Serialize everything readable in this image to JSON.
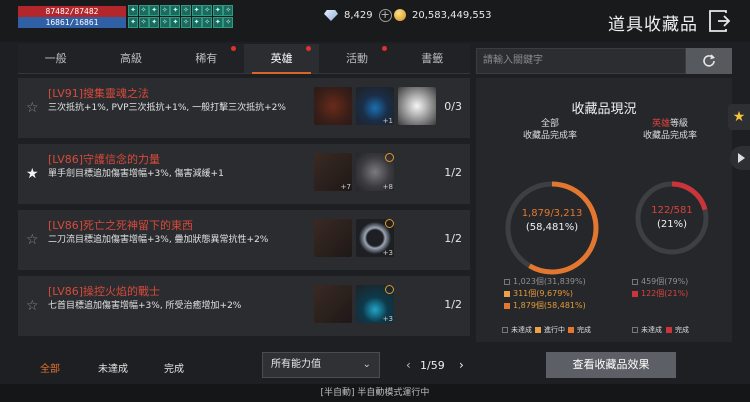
{
  "hud": {
    "hp": "87482/87482",
    "mp": "16861/16861",
    "buffs": [
      "✦",
      "✧",
      "✦",
      "✧",
      "✦",
      "✧",
      "✦",
      "✧",
      "✦",
      "✧",
      "✦",
      "✧",
      "✦",
      "✧",
      "✦",
      "✧",
      "✦",
      "✧",
      "✦",
      "✧"
    ]
  },
  "currency": {
    "diamonds": "8,429",
    "gold": "20,583,449,553"
  },
  "header": {
    "title": "道具收藏品"
  },
  "tabs": [
    {
      "label": "一般",
      "active": false,
      "dot": false
    },
    {
      "label": "高級",
      "active": false,
      "dot": false
    },
    {
      "label": "稀有",
      "active": false,
      "dot": true
    },
    {
      "label": "英雄",
      "active": true,
      "dot": true
    },
    {
      "label": "活動",
      "active": false,
      "dot": true
    },
    {
      "label": "書籤",
      "active": false,
      "dot": false
    }
  ],
  "collections": [
    {
      "title": "[LV91]搜集靈魂之法",
      "desc": "三次抵抗+1%, PVP三次抵抗+1%, 一般打擊三次抵抗+2%",
      "count": "0/3",
      "starred": false,
      "items": [
        {
          "icon": "i-dark",
          "sub": "",
          "check": false
        },
        {
          "icon": "i-gem",
          "sub": "+1",
          "check": false
        },
        {
          "icon": "i-wing",
          "sub": "",
          "check": false
        }
      ]
    },
    {
      "title": "[LV86]守護信念的力量",
      "desc": "單手劍目標追加傷害增幅+3%, 傷害減緩+1",
      "count": "1/2",
      "starred": true,
      "items": [
        {
          "icon": "i-sword",
          "sub": "+7",
          "check": false
        },
        {
          "icon": "i-armor",
          "sub": "+8",
          "check": true
        }
      ]
    },
    {
      "title": "[LV86]死亡之死神留下的東西",
      "desc": "二刀流目標追加傷害增幅+3%, 疊加狀態異常抗性+2%",
      "count": "1/2",
      "starred": false,
      "items": [
        {
          "icon": "i-sword",
          "sub": "",
          "check": false
        },
        {
          "icon": "i-ring",
          "sub": "+3",
          "check": true
        }
      ]
    },
    {
      "title": "[LV86]操控火焰的戰士",
      "desc": "七首目標追加傷害增幅+3%, 所受治癒增加+2%",
      "count": "1/2",
      "starred": false,
      "items": [
        {
          "icon": "i-sword",
          "sub": "",
          "check": false
        },
        {
          "icon": "i-neck",
          "sub": "+3",
          "check": true
        }
      ]
    }
  ],
  "bottom": {
    "filters": [
      {
        "label": "全部",
        "active": true
      },
      {
        "label": "未達成",
        "active": false
      },
      {
        "label": "完成",
        "active": false
      }
    ],
    "select_value": "所有能力值",
    "page": "1/59"
  },
  "footer_text": "[半自動] 半自動模式運行中",
  "search": {
    "placeholder": "請輸入關鍵字"
  },
  "stats": {
    "title": "收藏品現況",
    "total": {
      "label_line1": "全部",
      "label_line2": "收藏品完成率",
      "value": "1,879/3,213",
      "percent": "(58,481%)",
      "ratio": 0.5848,
      "legend": [
        {
          "text": "1,023個(31,839%)",
          "cls": ""
        },
        {
          "text": "311個(9,679%)",
          "cls": "orange",
          "sq": "o1"
        },
        {
          "text": "1,879個(58,481%)",
          "cls": "orange",
          "sq": "o2"
        }
      ]
    },
    "hero": {
      "label_line1": "英雄",
      "label_line1_suffix": "等級",
      "label_line2": "收藏品完成率",
      "value": "122/581",
      "percent": "(21%)",
      "ratio": 0.21,
      "legend": [
        {
          "text": "459個(79%)",
          "cls": ""
        },
        {
          "text": "122個(21%)",
          "cls": "red",
          "sq": "r"
        }
      ]
    },
    "keys": {
      "incomplete": "未達成",
      "in_progress": "進行中",
      "complete": "完成"
    }
  },
  "effect_button": "查看收藏品效果",
  "colors": {
    "accent": "#e5742d",
    "hero_red": "#c9353a",
    "title_red": "#d84a3a"
  }
}
